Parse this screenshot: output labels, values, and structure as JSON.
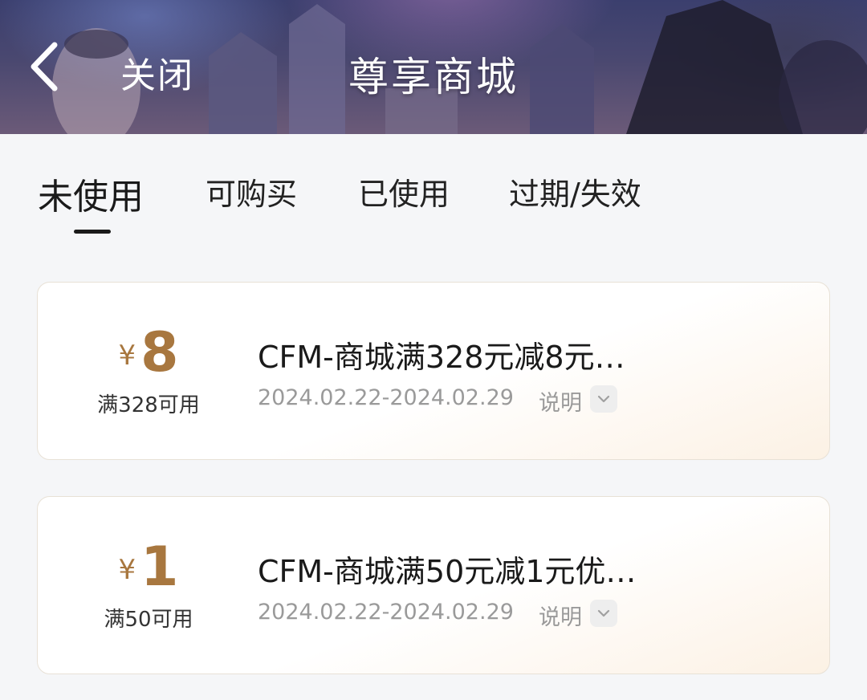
{
  "header": {
    "back_icon": "chevron-left-icon",
    "close_label": "关闭",
    "title": "尊享商城"
  },
  "tabs": [
    {
      "label": "未使用",
      "active": true
    },
    {
      "label": "可购买",
      "active": false
    },
    {
      "label": "已使用",
      "active": false
    },
    {
      "label": "过期/失效",
      "active": false
    }
  ],
  "coupons": [
    {
      "currency": "¥",
      "amount": "8",
      "threshold": "满328可用",
      "name": "CFM-商城满328元减8元…",
      "date_range": "2024.02.22-2024.02.29",
      "info_label": "说明",
      "info_icon": "chevron-down-icon"
    },
    {
      "currency": "¥",
      "amount": "1",
      "threshold": "满50可用",
      "name": "CFM-商城满50元减1元优…",
      "date_range": "2024.02.22-2024.02.29",
      "info_label": "说明",
      "info_icon": "chevron-down-icon"
    }
  ],
  "colors": {
    "accent": "#a8773f",
    "text_primary": "#1a1a1a",
    "text_secondary": "#9a9a9a",
    "background": "#f5f6f8"
  }
}
